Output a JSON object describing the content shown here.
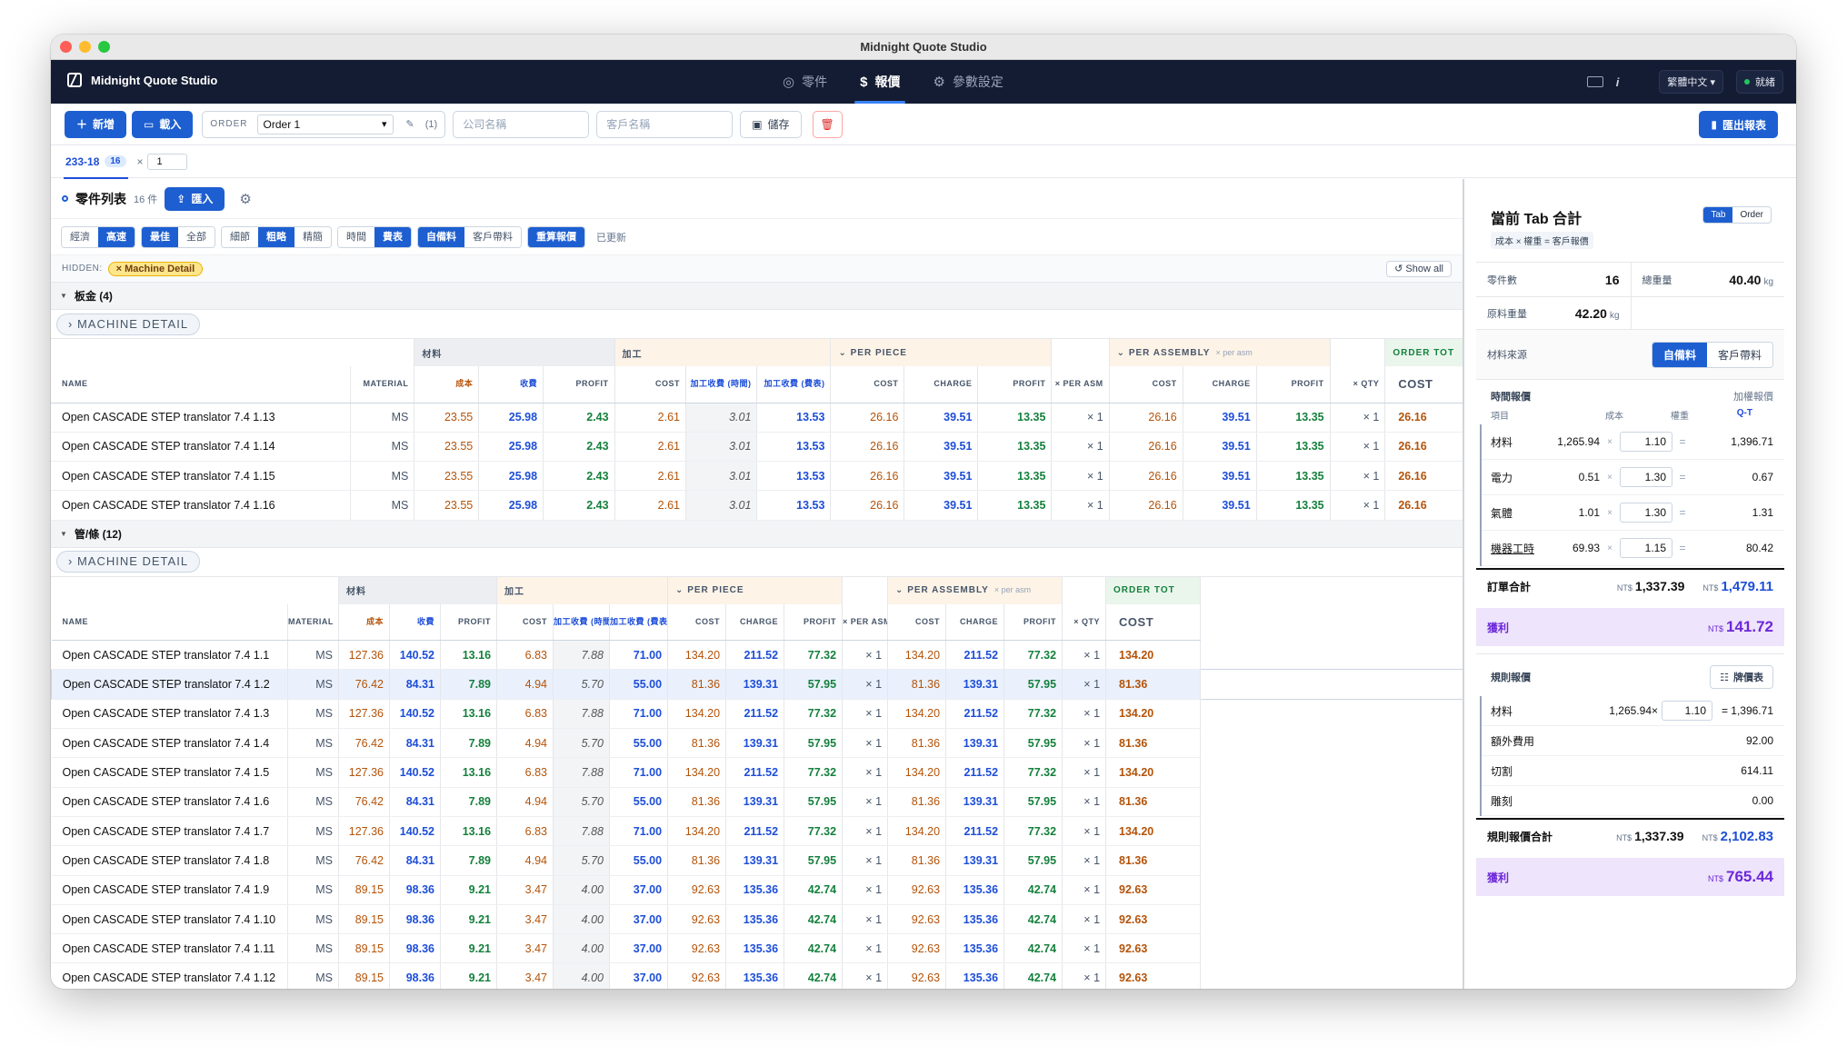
{
  "app": {
    "title": "Midnight Quote Studio",
    "brand": "Midnight Quote Studio"
  },
  "nav": {
    "tabs": [
      {
        "label": "零件"
      },
      {
        "label": "報價"
      },
      {
        "label": "參數設定"
      }
    ],
    "lang": "繁體中文 ▾",
    "status": "就緒",
    "info": "i"
  },
  "toolbar": {
    "new": "新增",
    "load": "載入",
    "order_label": "ORDER",
    "order_value": "Order 1",
    "order_count": "(1)",
    "company_placeholder": "公司名稱",
    "customer_placeholder": "客戶名稱",
    "save": "儲存",
    "export": "匯出報表"
  },
  "tab": {
    "name": "233-18",
    "count": "16",
    "mult_sign": "×",
    "mult": "1"
  },
  "parts": {
    "title": "零件列表",
    "count": "16 件",
    "import": "匯入"
  },
  "filters": {
    "g1": [
      "經濟",
      "高速"
    ],
    "g2": [
      "最佳",
      "全部"
    ],
    "g3": [
      "細節",
      "粗略",
      "精簡"
    ],
    "g4": [
      "時間",
      "費表"
    ],
    "g5": [
      "自備料",
      "客戶帶料"
    ],
    "recalc": "重算報價",
    "updated": "已更新"
  },
  "hidden": {
    "label": "HIDDEN:",
    "chip": "× Machine Detail",
    "show_all": "↺ Show all"
  },
  "groups": [
    {
      "title": "板金 (4)",
      "machine_detail": "› MACHINE DETAIL",
      "rows": [
        [
          "Open CASCADE STEP translator 7.4 1.13",
          "MS",
          "23.55",
          "25.98",
          "2.43",
          "2.61",
          "3.01",
          "13.53",
          "26.16",
          "39.51",
          "13.35",
          "× 1",
          "26.16",
          "39.51",
          "13.35",
          "× 1",
          "26.16"
        ],
        [
          "Open CASCADE STEP translator 7.4 1.14",
          "MS",
          "23.55",
          "25.98",
          "2.43",
          "2.61",
          "3.01",
          "13.53",
          "26.16",
          "39.51",
          "13.35",
          "× 1",
          "26.16",
          "39.51",
          "13.35",
          "× 1",
          "26.16"
        ],
        [
          "Open CASCADE STEP translator 7.4 1.15",
          "MS",
          "23.55",
          "25.98",
          "2.43",
          "2.61",
          "3.01",
          "13.53",
          "26.16",
          "39.51",
          "13.35",
          "× 1",
          "26.16",
          "39.51",
          "13.35",
          "× 1",
          "26.16"
        ],
        [
          "Open CASCADE STEP translator 7.4 1.16",
          "MS",
          "23.55",
          "25.98",
          "2.43",
          "2.61",
          "3.01",
          "13.53",
          "26.16",
          "39.51",
          "13.35",
          "× 1",
          "26.16",
          "39.51",
          "13.35",
          "× 1",
          "26.16"
        ]
      ]
    },
    {
      "title": "管/條 (12)",
      "machine_detail": "› MACHINE DETAIL",
      "rows": [
        [
          "Open CASCADE STEP translator 7.4 1.1",
          "MS",
          "127.36",
          "140.52",
          "13.16",
          "6.83",
          "7.88",
          "71.00",
          "134.20",
          "211.52",
          "77.32",
          "× 1",
          "134.20",
          "211.52",
          "77.32",
          "× 1",
          "134.20"
        ],
        [
          "Open CASCADE STEP translator 7.4 1.2",
          "MS",
          "76.42",
          "84.31",
          "7.89",
          "4.94",
          "5.70",
          "55.00",
          "81.36",
          "139.31",
          "57.95",
          "× 1",
          "81.36",
          "139.31",
          "57.95",
          "× 1",
          "81.36"
        ],
        [
          "Open CASCADE STEP translator 7.4 1.3",
          "MS",
          "127.36",
          "140.52",
          "13.16",
          "6.83",
          "7.88",
          "71.00",
          "134.20",
          "211.52",
          "77.32",
          "× 1",
          "134.20",
          "211.52",
          "77.32",
          "× 1",
          "134.20"
        ],
        [
          "Open CASCADE STEP translator 7.4 1.4",
          "MS",
          "76.42",
          "84.31",
          "7.89",
          "4.94",
          "5.70",
          "55.00",
          "81.36",
          "139.31",
          "57.95",
          "× 1",
          "81.36",
          "139.31",
          "57.95",
          "× 1",
          "81.36"
        ],
        [
          "Open CASCADE STEP translator 7.4 1.5",
          "MS",
          "127.36",
          "140.52",
          "13.16",
          "6.83",
          "7.88",
          "71.00",
          "134.20",
          "211.52",
          "77.32",
          "× 1",
          "134.20",
          "211.52",
          "77.32",
          "× 1",
          "134.20"
        ],
        [
          "Open CASCADE STEP translator 7.4 1.6",
          "MS",
          "76.42",
          "84.31",
          "7.89",
          "4.94",
          "5.70",
          "55.00",
          "81.36",
          "139.31",
          "57.95",
          "× 1",
          "81.36",
          "139.31",
          "57.95",
          "× 1",
          "81.36"
        ],
        [
          "Open CASCADE STEP translator 7.4 1.7",
          "MS",
          "127.36",
          "140.52",
          "13.16",
          "6.83",
          "7.88",
          "71.00",
          "134.20",
          "211.52",
          "77.32",
          "× 1",
          "134.20",
          "211.52",
          "77.32",
          "× 1",
          "134.20"
        ],
        [
          "Open CASCADE STEP translator 7.4 1.8",
          "MS",
          "76.42",
          "84.31",
          "7.89",
          "4.94",
          "5.70",
          "55.00",
          "81.36",
          "139.31",
          "57.95",
          "× 1",
          "81.36",
          "139.31",
          "57.95",
          "× 1",
          "81.36"
        ],
        [
          "Open CASCADE STEP translator 7.4 1.9",
          "MS",
          "89.15",
          "98.36",
          "9.21",
          "3.47",
          "4.00",
          "37.00",
          "92.63",
          "135.36",
          "42.74",
          "× 1",
          "92.63",
          "135.36",
          "42.74",
          "× 1",
          "92.63"
        ],
        [
          "Open CASCADE STEP translator 7.4 1.10",
          "MS",
          "89.15",
          "98.36",
          "9.21",
          "3.47",
          "4.00",
          "37.00",
          "92.63",
          "135.36",
          "42.74",
          "× 1",
          "92.63",
          "135.36",
          "42.74",
          "× 1",
          "92.63"
        ],
        [
          "Open CASCADE STEP translator 7.4 1.11",
          "MS",
          "89.15",
          "98.36",
          "9.21",
          "3.47",
          "4.00",
          "37.00",
          "92.63",
          "135.36",
          "42.74",
          "× 1",
          "92.63",
          "135.36",
          "42.74",
          "× 1",
          "92.63"
        ],
        [
          "Open CASCADE STEP translator 7.4 1.12",
          "MS",
          "89.15",
          "98.36",
          "9.21",
          "3.47",
          "4.00",
          "37.00",
          "92.63",
          "135.36",
          "42.74",
          "× 1",
          "92.63",
          "135.36",
          "42.74",
          "× 1",
          "92.63"
        ]
      ]
    }
  ],
  "table": {
    "group_headers": {
      "material": "材料",
      "process": "加工",
      "per_piece": "⌄ PER PIECE",
      "per_assembly": "⌄ PER ASSEMBLY",
      "per_asm_note": "× per asm",
      "order_total": "ORDER TOT"
    },
    "columns": [
      "NAME",
      "MATERIAL",
      "成本",
      "收費",
      "PROFIT",
      "COST",
      "加工收費 (時間)",
      "加工收費 (費表)",
      "COST",
      "CHARGE",
      "PROFIT",
      "× PER ASM",
      "COST",
      "CHARGE",
      "PROFIT",
      "× QTY",
      "COST"
    ]
  },
  "summary": {
    "title": "當前 Tab 合計",
    "formula": "成本 × 權重 = 客戶報價",
    "toggle": [
      "Tab",
      "Order"
    ],
    "parts_count_label": "零件數",
    "parts_count": "16",
    "total_weight_label": "總重量",
    "total_weight": "40.40",
    "weight_unit": "kg",
    "raw_weight_label": "原料重量",
    "raw_weight": "42.20",
    "source_label": "材料來源",
    "source_options": [
      "自備料",
      "客戶帶料"
    ],
    "time_title": "時間報價",
    "time_alt": "加權報價",
    "cols": [
      "項目",
      "成本",
      "權重",
      "Q-T"
    ],
    "time_lines": [
      {
        "name": "材料",
        "cost": "1,265.94",
        "weight": "1.10",
        "result": "1,396.71"
      },
      {
        "name": "電力",
        "cost": "0.51",
        "weight": "1.30",
        "result": "0.67"
      },
      {
        "name": "氣體",
        "cost": "1.01",
        "weight": "1.30",
        "result": "1.31"
      },
      {
        "name": "機器工時",
        "cost": "69.93",
        "weight": "1.15",
        "result": "80.42"
      }
    ],
    "order_total_label": "訂單合計",
    "currency": "NT$",
    "order_cost": "1,337.39",
    "order_charge": "1,479.11",
    "profit_label": "獲利",
    "order_profit": "141.72",
    "rule_title": "規則報價",
    "price_table": "牌價表",
    "rule_material": {
      "name": "材料",
      "cost": "1,265.94×",
      "weight": "1.10",
      "result": "= 1,396.71"
    },
    "rule_lines": [
      {
        "name": "額外費用",
        "value": "92.00"
      },
      {
        "name": "切割",
        "value": "614.11"
      },
      {
        "name": "雕刻",
        "value": "0.00"
      }
    ],
    "rule_total_label": "規則報價合計",
    "rule_cost": "1,337.39",
    "rule_charge": "2,102.83",
    "rule_profit": "765.44"
  }
}
